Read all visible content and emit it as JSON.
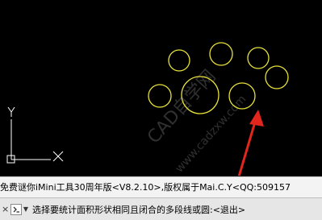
{
  "viewport": {
    "background": "#000000",
    "circle_color": "#e8e23a",
    "arrow_color": "#e2261d",
    "ucs_color": "#ffffff",
    "ucs_x_label": "X",
    "ucs_y_label": "Y",
    "watermark_brand": "CAD自学网",
    "watermark_url": "www.cadzxw.com"
  },
  "command_history": {
    "text": "免费谜你iMini工具30周年版<V8.2.10>,版权属于Mai.C.Y<QQ:509157"
  },
  "command_line": {
    "close_icon": "close-icon",
    "prompt_icon": "command-prompt-icon",
    "prompt": "选择要统计面积形状相同且闭合的多段线或圆:<退出>"
  }
}
